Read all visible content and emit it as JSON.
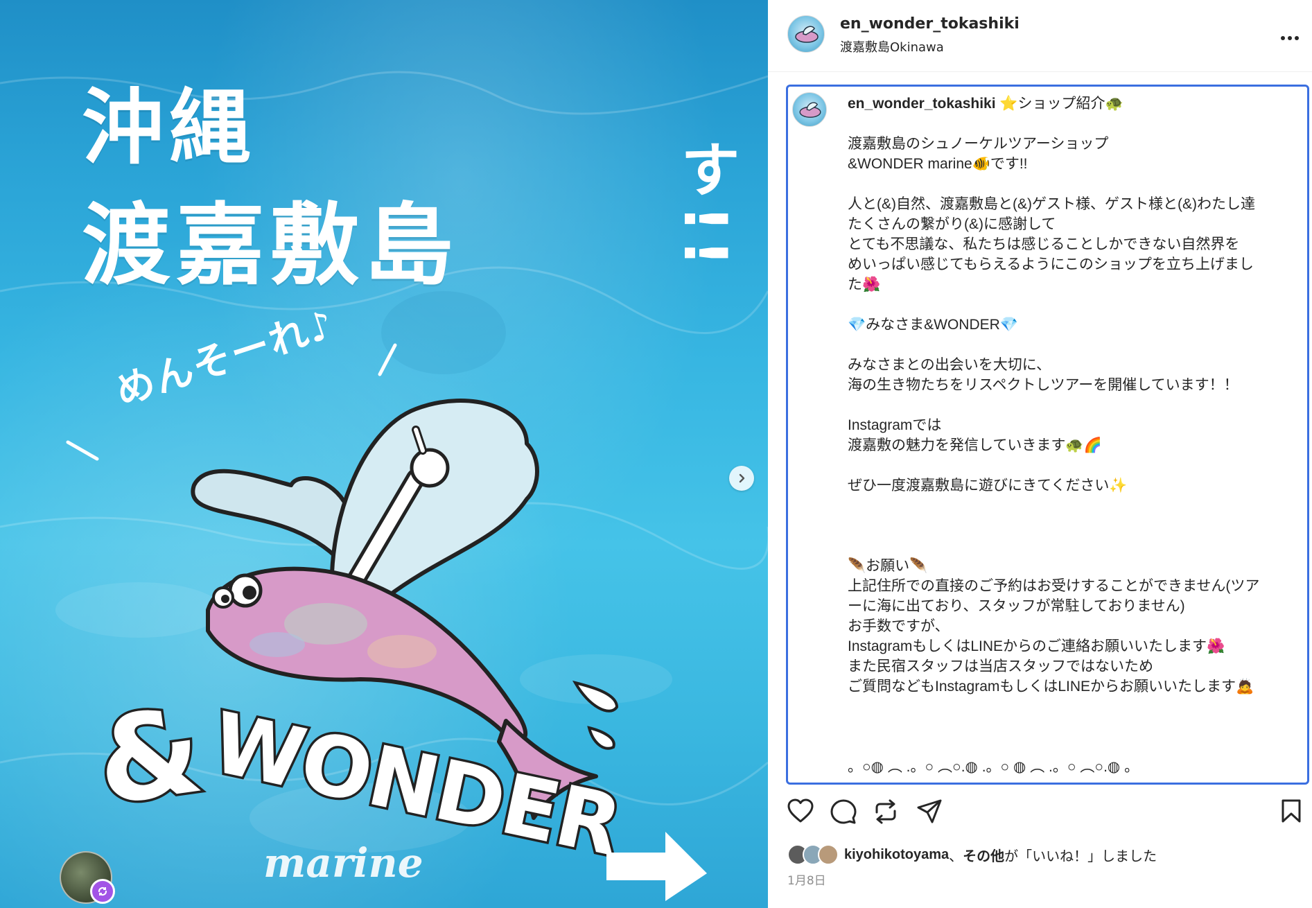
{
  "media": {
    "title_line1": "沖縄",
    "title_line2": "渡嘉敷島",
    "menso_text": "めんそーれ♪",
    "vertical_text": "こんなショップです!!",
    "logo_text": "&WONDER",
    "logo_subtext": "marine"
  },
  "header": {
    "username": "en_wonder_tokashiki",
    "location": "渡嘉敷島Okinawa",
    "more_label": "..."
  },
  "caption": {
    "username": "en_wonder_tokashiki",
    "first_line": " ⭐ショップ紹介🐢",
    "body": "\n\n渡嘉敷島のシュノーケルツアーショップ\n&WONDER marine🐠です!!\n\n人と(&)自然、渡嘉敷島と(&)ゲスト様、ゲスト様と(&)わたし達\nたくさんの繋がり(&)に感謝して\nとても不思議な、私たちは感じることしかできない自然界を\nめいっぱい感じてもらえるようにこのショップを立ち上げまし\nた🌺\n\n💎みなさま&WONDER💎\n\nみなさまとの出会いを大切に、\n海の生き物たちをリスペクトしツアーを開催しています！！\n\nInstagramでは\n渡嘉敷の魅力を発信していきます🐢🌈\n\nぜひ一度渡嘉敷島に遊びにきてください✨\n\n\n\n🪶お願い🪶\n上記住所での直接のご予約はお受けすることができません(ツア\nーに海に出ており、スタッフが常駐しておりません)\nお手数ですが、\nInstagramもしくはLINEからのご連絡お願いいたします🌺\nまた民宿スタッフは当店スタッフではないため\nご質問などもInstagramもしくはLINEからお願いいたします🙇\n\n\n\n。○◍ ︵ .。○ ︵○.◍ .。○ ◍ ︵ .。○ ︵○.◍ 。"
  },
  "actions": {
    "like": "heart-icon",
    "comment": "comment-icon",
    "share": "repost-icon",
    "send": "send-icon",
    "save": "bookmark-icon"
  },
  "likes": {
    "liked_by": "kiyohikotoyama",
    "separator": "、",
    "others": "その他",
    "suffix": "が「いいね！」しました"
  },
  "date": "1月8日",
  "colors": {
    "caption_border": "#3b6fe0",
    "ocean": "#37b6e2",
    "fish_pink": "#d79ac8",
    "wing": "#cfe6ee"
  }
}
